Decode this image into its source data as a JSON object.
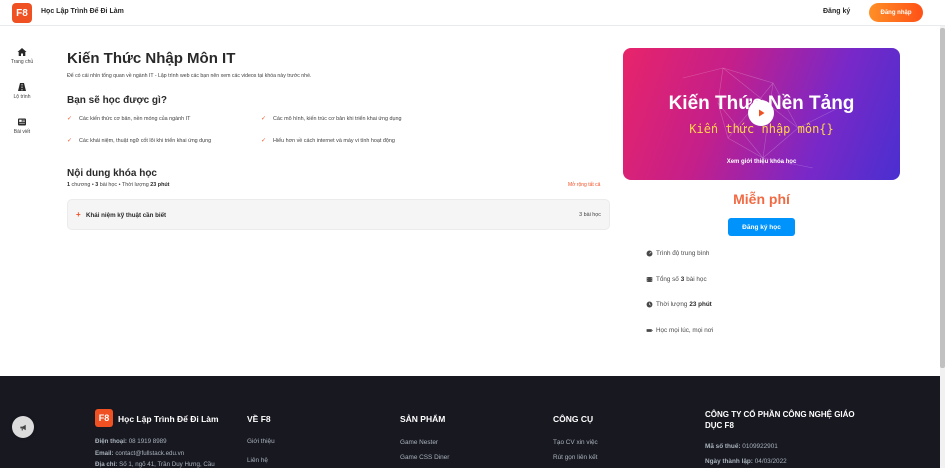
{
  "header": {
    "logo_text": "F8",
    "brand": "Học Lập Trình Để Đi Làm",
    "signup": "Đăng ký",
    "login": "Đăng nhập"
  },
  "sidebar": {
    "items": [
      {
        "label": "Trang chủ",
        "icon": "home-icon"
      },
      {
        "label": "Lộ trình",
        "icon": "road-icon"
      },
      {
        "label": "Bài viết",
        "icon": "newspaper-icon"
      }
    ]
  },
  "course": {
    "title": "Kiến Thức Nhập Môn IT",
    "description": "Để có cái nhìn tổng quan về ngành IT - Lập trình web các bạn nên xem các videos tại khóa này trước nhé.",
    "learn_heading": "Bạn sẽ học được gì?",
    "learn_items": [
      "Các kiến thức cơ bản, nền móng của ngành IT",
      "Các mô hình, kiến trúc cơ bản khi triển khai ứng dụng",
      "Các khái niệm, thuật ngữ cốt lõi khi triển khai ứng dụng",
      "Hiểu hơn về cách internet và máy vi tính hoạt động"
    ],
    "content_heading": "Nội dung khóa học",
    "meta": {
      "chapters": "1",
      "chapters_label": "chương",
      "lessons": "3",
      "lessons_label": "bài học",
      "duration_label": "Thời lượng",
      "duration": "23 phút"
    },
    "expand_all": "Mở rộng tất cả",
    "chapters": [
      {
        "title": "Khái niệm kỹ thuật cần biết",
        "count": "3 bài học"
      }
    ]
  },
  "preview": {
    "title": "Kiến Thức Nền Tảng",
    "subtitle": "Kiến thức nhập môn{}",
    "caption": "Xem giới thiệu khóa học"
  },
  "price": "Miễn phí",
  "enroll": "Đăng ký học",
  "info": {
    "level": "Trình độ trung bình",
    "total_label": "Tổng số",
    "total_value": "3",
    "total_suffix": "bài học",
    "duration_label": "Thời lượng",
    "duration_value": "23 phút",
    "anywhere": "Học mọi lúc, mọi nơi"
  },
  "footer": {
    "logo_text": "F8",
    "brand": "Học Lập Trình Để Đi Làm",
    "phone_label": "Điện thoại:",
    "phone": "08 1919 8989",
    "email_label": "Email:",
    "email": "contact@fullstack.edu.vn",
    "address_label": "Địa chỉ:",
    "address": "Số 1, ngõ 41, Trần Duy Hưng, Cầu",
    "col_about": {
      "title": "VỀ F8",
      "links": [
        "Giới thiệu",
        "Liên hệ"
      ]
    },
    "col_products": {
      "title": "SẢN PHẨM",
      "links": [
        "Game Nester",
        "Game CSS Diner"
      ]
    },
    "col_tools": {
      "title": "CÔNG CỤ",
      "links": [
        "Tạo CV xin việc",
        "Rút gọn liên kết"
      ]
    },
    "company": "CÔNG TY CỔ PHẦN CÔNG NGHỆ GIÁO DỤC F8",
    "tax_label": "Mã số thuế:",
    "tax": "0109922901",
    "founded_label": "Ngày thành lập:",
    "founded": "04/03/2022"
  },
  "colors": {
    "accent": "#f05123",
    "enroll_blue": "#0093fc",
    "footer_bg": "#181821"
  }
}
